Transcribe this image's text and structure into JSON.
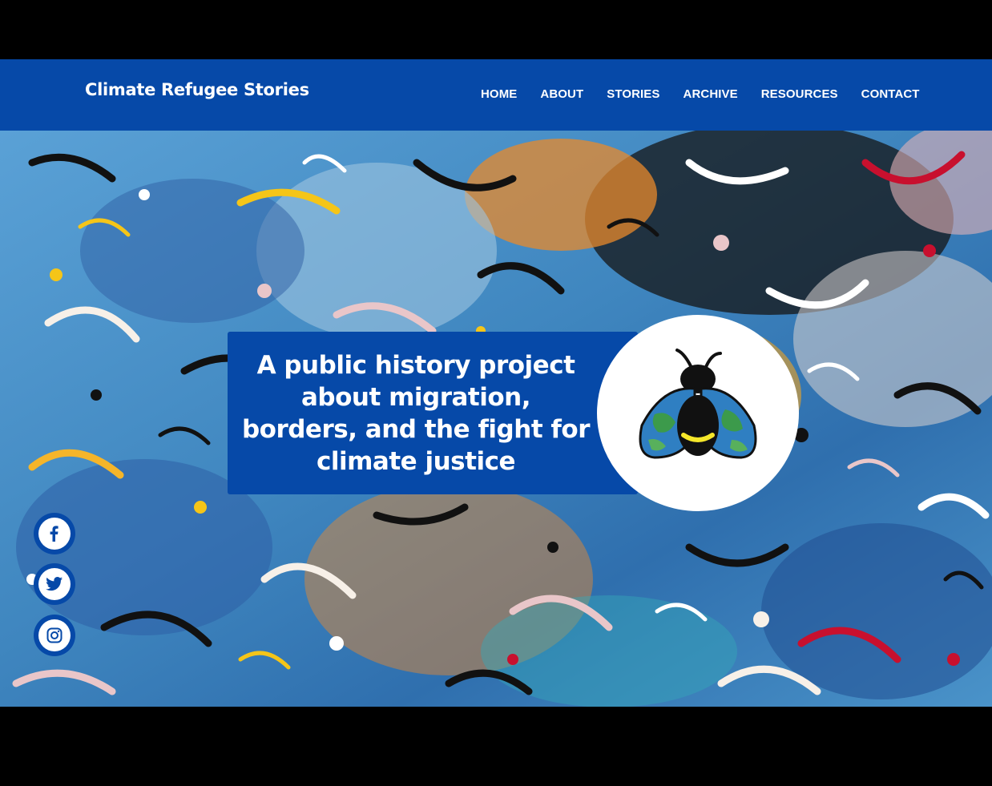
{
  "site": {
    "title": "Climate Refugee Stories"
  },
  "nav": {
    "items": [
      {
        "label": "HOME"
      },
      {
        "label": "ABOUT"
      },
      {
        "label": "STORIES"
      },
      {
        "label": "ARCHIVE"
      },
      {
        "label": "RESOURCES"
      },
      {
        "label": "CONTACT"
      }
    ]
  },
  "hero": {
    "tagline": "A public history project about migration, borders, and the fight for climate justice",
    "logo_icon": "firefly-earth-icon"
  },
  "social": [
    {
      "icon": "facebook-icon"
    },
    {
      "icon": "twitter-icon"
    },
    {
      "icon": "instagram-icon"
    }
  ],
  "colors": {
    "brand_blue": "#0649a8",
    "text_white": "#ffffff",
    "frame_black": "#000000"
  }
}
